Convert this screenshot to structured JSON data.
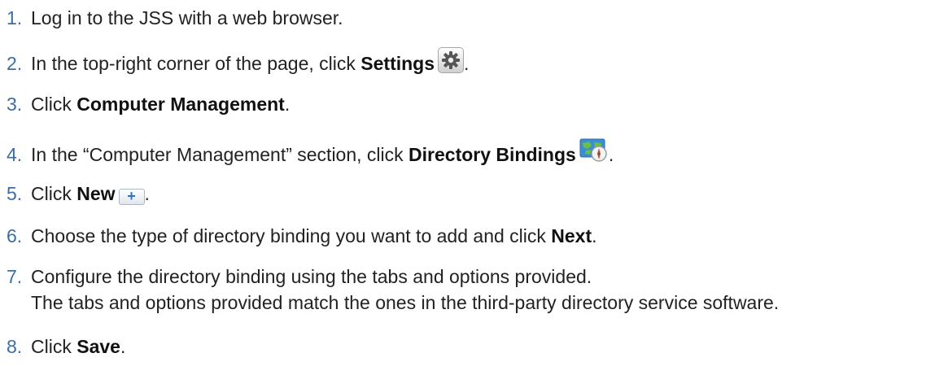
{
  "steps": [
    {
      "num": "1.",
      "text": "Log in to the JSS with a web browser."
    },
    {
      "num": "2.",
      "pre": "In the top-right corner of the page, click ",
      "bold": "Settings",
      "icon": "gear-icon",
      "post": "."
    },
    {
      "num": "3.",
      "pre": "Click ",
      "bold": "Computer Management",
      "post": "."
    },
    {
      "num": "4.",
      "pre": "In the “Computer Management” section, click ",
      "bold": "Directory Bindings",
      "icon": "directory-bindings-icon",
      "post": "."
    },
    {
      "num": "5.",
      "pre": "Click ",
      "bold": "New",
      "icon": "plus-icon",
      "icon_glyph": "+",
      "post": "."
    },
    {
      "num": "6.",
      "pre": "Choose the type of directory binding you want to add and click ",
      "bold": "Next",
      "post": "."
    },
    {
      "num": "7.",
      "text": "Configure the directory binding using the tabs and options provided.",
      "sub": "The tabs and options provided match the ones in the third-party directory service software."
    },
    {
      "num": "8.",
      "pre": "Click ",
      "bold": "Save",
      "post": "."
    }
  ]
}
